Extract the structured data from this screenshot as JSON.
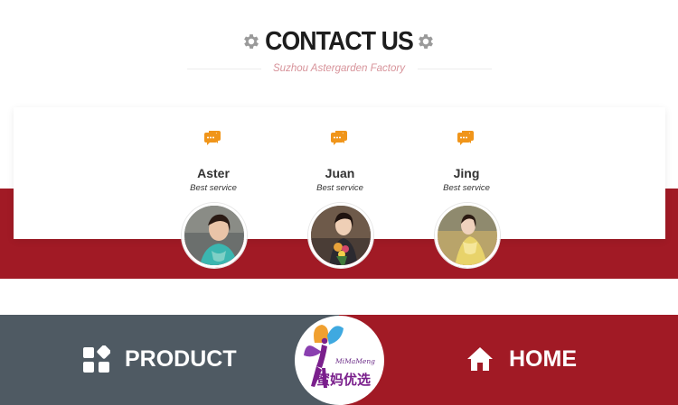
{
  "header": {
    "title": "CONTACT US",
    "subtitle": "Suzhou Astergarden Factory"
  },
  "contacts": [
    {
      "name": "Aster",
      "role": "Best service"
    },
    {
      "name": "Juan",
      "role": "Best service"
    },
    {
      "name": "Jing",
      "role": "Best service"
    }
  ],
  "nav": {
    "product_label": "PRODUCT",
    "home_label": "HOME"
  },
  "logo": {
    "latin": "MiMaMeng",
    "chinese": "蜜妈优选"
  },
  "colors": {
    "accent_red": "#a11a25",
    "slate": "#4f5a63",
    "chat_icon": "#f0951a",
    "subtitle_pink": "#d7939a"
  },
  "icons": {
    "gear": "gear-icon",
    "chat": "chat-bubble-icon",
    "product": "grid-icon",
    "home": "home-icon"
  }
}
